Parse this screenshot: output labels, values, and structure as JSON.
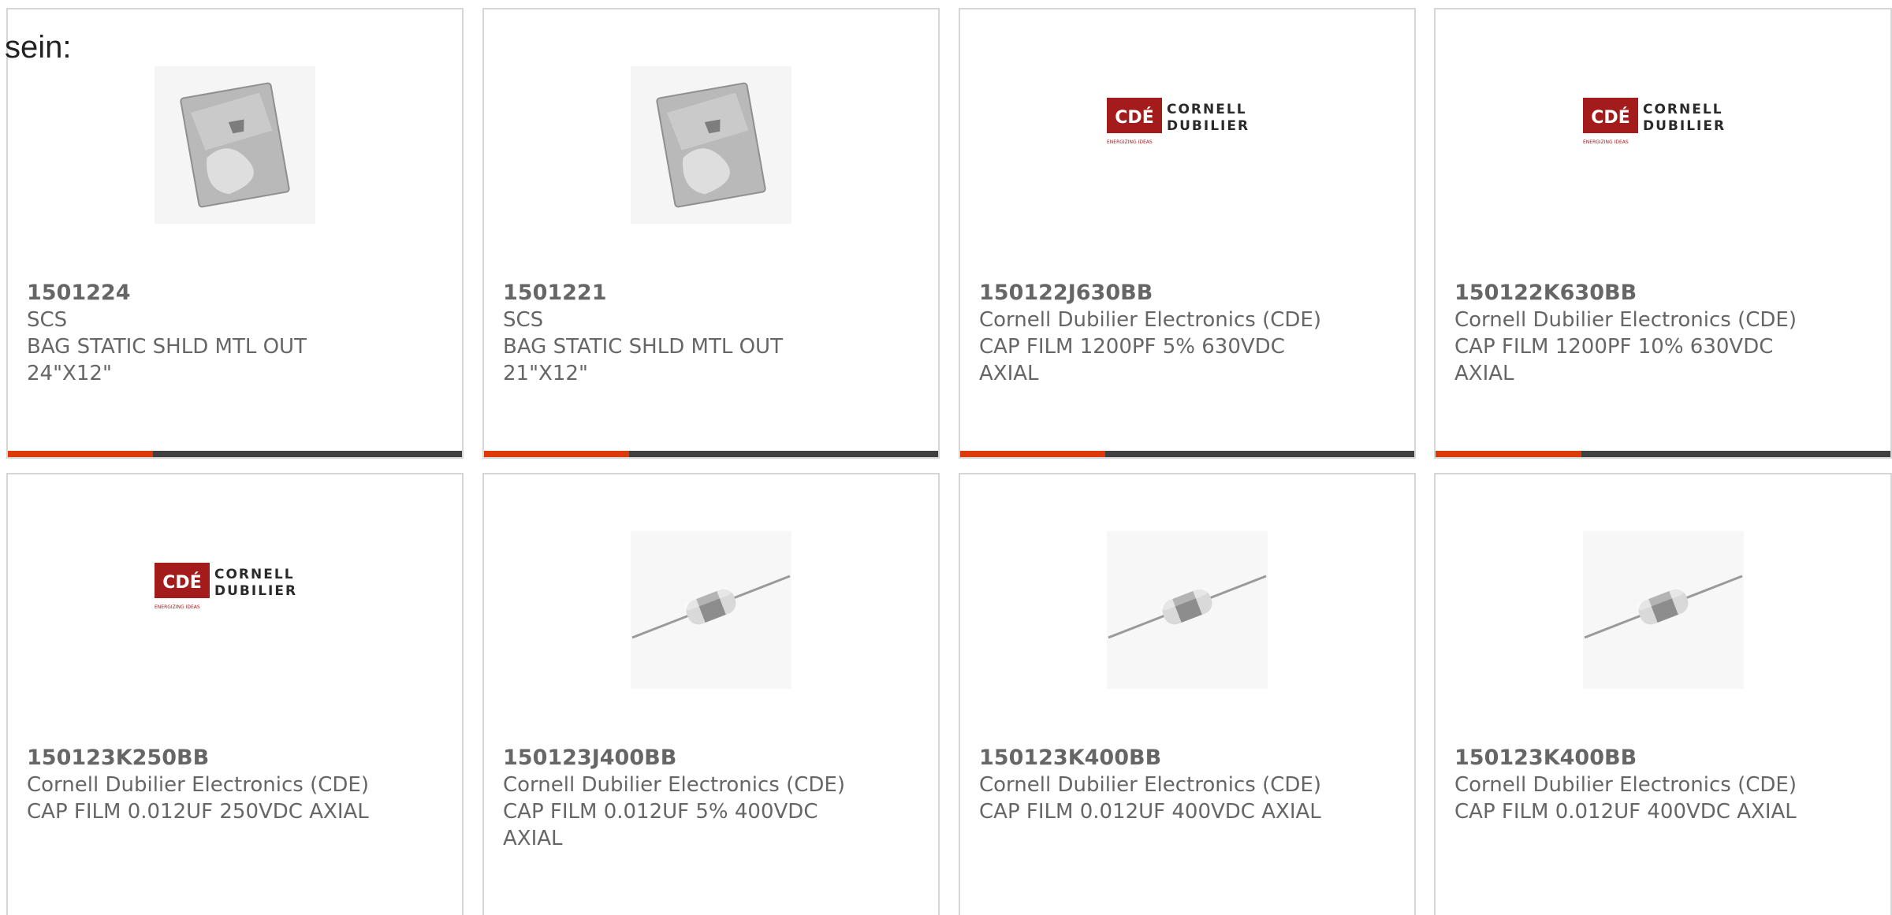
{
  "intro_text": "sein:",
  "accent_color": "#dd3a0a",
  "bar_color": "#404040",
  "cards": [
    {
      "part": "1501224",
      "maker": "SCS",
      "desc": "BAG STATIC SHLD MTL OUT 24\"X12\"",
      "image": "bag-icon"
    },
    {
      "part": "1501221",
      "maker": "SCS",
      "desc": "BAG STATIC SHLD MTL OUT 21\"X12\"",
      "image": "bag-icon"
    },
    {
      "part": "150122J630BB",
      "maker": "Cornell Dubilier Electronics (CDE)",
      "desc": "CAP FILM 1200PF 5% 630VDC AXIAL",
      "image": "cde-logo"
    },
    {
      "part": "150122K630BB",
      "maker": "Cornell Dubilier Electronics (CDE)",
      "desc": "CAP FILM 1200PF 10% 630VDC AXIAL",
      "image": "cde-logo"
    },
    {
      "part": "150123K250BB",
      "maker": "Cornell Dubilier Electronics (CDE)",
      "desc": "CAP FILM 0.012UF 250VDC AXIAL",
      "image": "cde-logo"
    },
    {
      "part": "150123J400BB",
      "maker": "Cornell Dubilier Electronics (CDE)",
      "desc": "CAP FILM 0.012UF 5% 400VDC AXIAL",
      "image": "axial-capacitor-icon"
    },
    {
      "part": "150123K400BB",
      "maker": "Cornell Dubilier Electronics (CDE)",
      "desc": "CAP FILM 0.012UF 400VDC AXIAL",
      "image": "axial-capacitor-icon"
    },
    {
      "part": "150123K400BB",
      "maker": "Cornell Dubilier Electronics (CDE)",
      "desc": "CAP FILM 0.012UF 400VDC AXIAL",
      "image": "axial-capacitor-icon"
    }
  ],
  "logo": {
    "badge_text": "CDÉ",
    "name_line1": "CORNELL",
    "name_line2": "DUBILIER",
    "tagline": "ENERGIZING IDEAS"
  }
}
